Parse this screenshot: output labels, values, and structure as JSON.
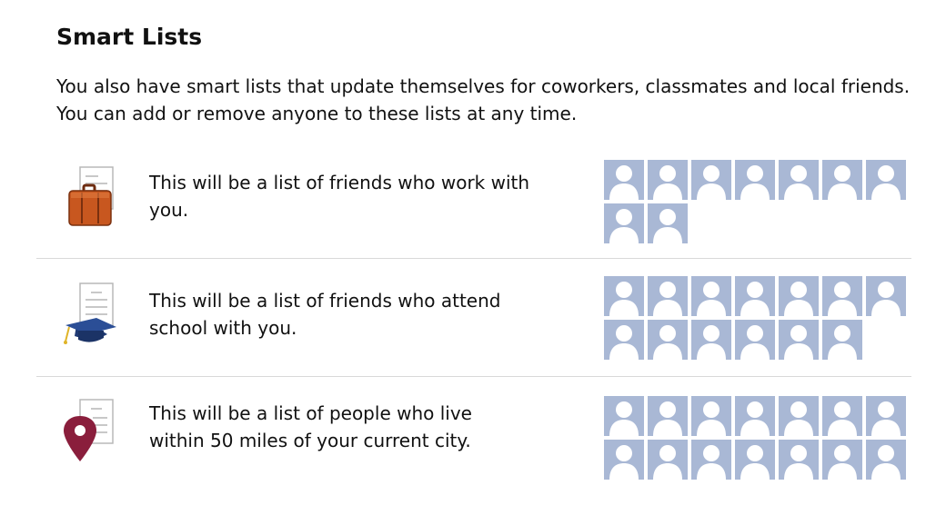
{
  "title": "Smart Lists",
  "intro": "You also have smart lists that update themselves for coworkers, classmates and local friends. You can add or remove anyone to these lists at any time.",
  "lists": [
    {
      "icon": "briefcase-icon",
      "description": "This will be a list of friends who work with you.",
      "avatar_count": 9
    },
    {
      "icon": "graduation-cap-icon",
      "description": "This will be a list of friends who attend school with you.",
      "avatar_count": 13
    },
    {
      "icon": "map-pin-icon",
      "description": "This will be a list of people who live within 50 miles of your current city.",
      "avatar_count": 14
    }
  ],
  "colors": {
    "avatar_fill": "#a9b8d5",
    "briefcase": "#c0521f",
    "cap": "#243f7a",
    "pin": "#8a1e3c"
  }
}
